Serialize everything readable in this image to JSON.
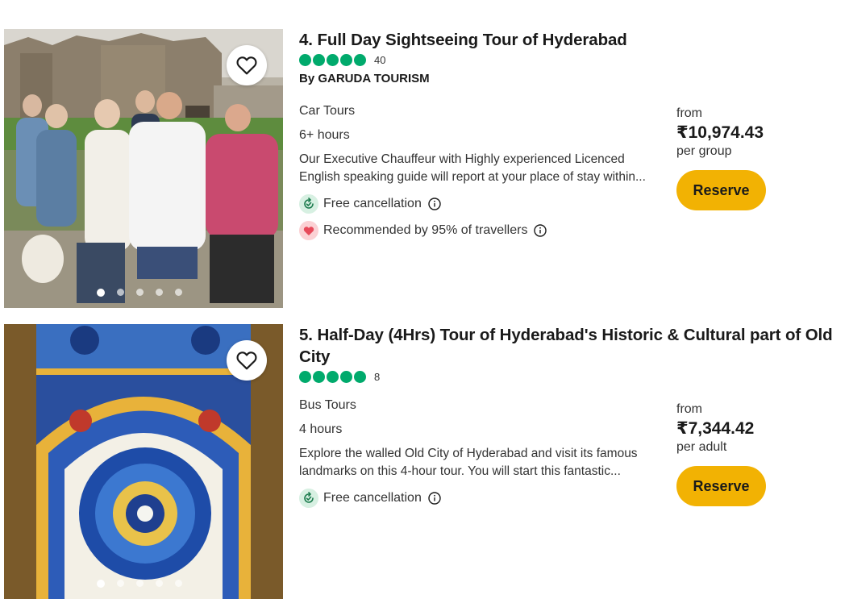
{
  "listings": [
    {
      "title": "4. Full Day Sightseeing Tour of Hyderabad",
      "rating_bubbles": 5,
      "review_count": "40",
      "operator": "By GARUDA TOURISM",
      "category": "Car Tours",
      "duration": "6+ hours",
      "description": "Our Executive Chauffeur with Highly experienced Licenced English speaking guide will report at your place of stay within...",
      "features": {
        "free_cancellation": "Free cancellation",
        "recommended": "Recommended by 95% of travellers"
      },
      "price": {
        "from_label": "from",
        "amount": "₹10,974.43",
        "unit": "per group"
      },
      "reserve_label": "Reserve",
      "carousel": {
        "total": 5,
        "active": 1
      }
    },
    {
      "title": "5. Half-Day (4Hrs) Tour of Hyderabad's Historic & Cultural part of Old City",
      "rating_bubbles": 5,
      "review_count": "8",
      "category": "Bus Tours",
      "duration": "4 hours",
      "description": "Explore the walled Old City of Hyderabad and visit its famous landmarks on this 4-hour tour. You will start this fantastic...",
      "features": {
        "free_cancellation": "Free cancellation"
      },
      "price": {
        "from_label": "from",
        "amount": "₹7,344.42",
        "unit": "per adult"
      },
      "reserve_label": "Reserve",
      "carousel": {
        "total": 5,
        "active": 1
      }
    }
  ],
  "icons": {
    "heart": "heart-outline-icon",
    "bubble": "rating-bubble-icon",
    "cancellation": "refresh-check-icon",
    "recommended": "heart-filled-icon",
    "info": "info-circle-icon"
  },
  "colors": {
    "rating_green": "#00aa6c",
    "reserve_yellow": "#f2b203",
    "cancellation_bg": "#d7f0e2",
    "recommend_bg": "#fbd1d4",
    "recommend_heart": "#e74a5a"
  }
}
